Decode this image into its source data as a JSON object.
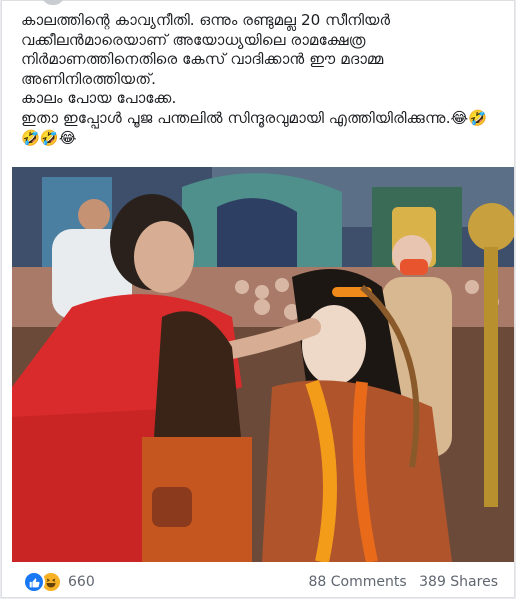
{
  "post": {
    "text": "കാലത്തിന്റെ കാവ്യനീതി. ഒന്നും രണ്ടുമല്ല 20 സീനിയർ വക്കീലൻമാരെയാണ് അയോധ്യയിലെ രാമക്ഷേത്ര നിർമാണത്തിനെതിരെ കേസ് വാദിക്കാൻ ഈ മദാമ്മ അണിനിരത്തിയത്.\nകാലം പോയ പോക്കേ.\nഇതാ ഇപ്പോൾ പൂജ പന്തലിൽ സിന്ദൂരവുമായി എത്തിയിരിക്കുന്നു.😂🤣🤣🤣😂"
  },
  "photo": {
    "description_icon": "photo-image"
  },
  "footer": {
    "reaction_count": "660",
    "comments": "88 Comments",
    "shares": "389 Shares",
    "reaction_icons": [
      "like-icon",
      "haha-icon"
    ],
    "colors": {
      "like": "#1877f2",
      "haha": "#f7b125"
    }
  }
}
